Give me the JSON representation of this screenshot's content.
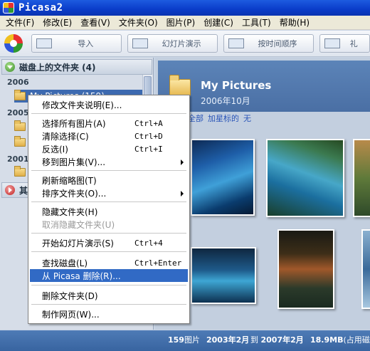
{
  "window": {
    "title": "Picasa2"
  },
  "menubar": [
    "文件(F)",
    "修改(E)",
    "查看(V)",
    "文件夹(O)",
    "图片(P)",
    "创建(C)",
    "工具(T)",
    "帮助(H)"
  ],
  "toolbar": {
    "import_label": "导入",
    "slideshow_label": "幻灯片演示",
    "timeline_label": "按时间顺序",
    "gift_label": "礼"
  },
  "left_panel": {
    "folders_on_disk": "磁盘上的文件夹 (4)",
    "other_section": "其",
    "years": [
      "2006",
      "2005",
      "2001"
    ],
    "selected_folder": "My Pictures (159)"
  },
  "main": {
    "folder_title": "My Pictures",
    "folder_date": "2006年10月",
    "filters": [
      "全部",
      "加星标的",
      "无"
    ]
  },
  "context_menu": {
    "items": [
      {
        "label": "修改文件夹说明(E)...",
        "shortcut": "",
        "submenu": false,
        "disabled": false,
        "highlighted": false
      },
      {
        "label": "选择所有图片(A)",
        "shortcut": "Ctrl+A",
        "submenu": false,
        "disabled": false,
        "highlighted": false
      },
      {
        "label": "清除选择(C)",
        "shortcut": "Ctrl+D",
        "submenu": false,
        "disabled": false,
        "highlighted": false
      },
      {
        "label": "反选(I)",
        "shortcut": "Ctrl+I",
        "submenu": false,
        "disabled": false,
        "highlighted": false
      },
      {
        "label": "移到图片集(V)...",
        "shortcut": "",
        "submenu": true,
        "disabled": false,
        "highlighted": false
      },
      {
        "label": "刷新缩略图(T)",
        "shortcut": "",
        "submenu": false,
        "disabled": false,
        "highlighted": false
      },
      {
        "label": "排序文件夹(O)...",
        "shortcut": "",
        "submenu": true,
        "disabled": false,
        "highlighted": false
      },
      {
        "label": "隐藏文件夹(H)",
        "shortcut": "",
        "submenu": false,
        "disabled": false,
        "highlighted": false
      },
      {
        "label": "取消隐藏文件夹(U)",
        "shortcut": "",
        "submenu": false,
        "disabled": true,
        "highlighted": false
      },
      {
        "label": "开始幻灯片演示(S)",
        "shortcut": "Ctrl+4",
        "submenu": false,
        "disabled": false,
        "highlighted": false
      },
      {
        "label": "查找磁盘(L)",
        "shortcut": "Ctrl+Enter",
        "submenu": false,
        "disabled": false,
        "highlighted": false
      },
      {
        "label": "从 Picasa 删除(R)...",
        "shortcut": "",
        "submenu": false,
        "disabled": false,
        "highlighted": true
      },
      {
        "label": "删除文件夹(D)",
        "shortcut": "",
        "submenu": false,
        "disabled": false,
        "highlighted": false
      },
      {
        "label": "制作网页(W)...",
        "shortcut": "",
        "submenu": false,
        "disabled": false,
        "highlighted": false
      }
    ]
  },
  "statusbar": {
    "count": "159",
    "count_unit": "图片",
    "date_from": "2003年2月",
    "to_word": "到",
    "date_to": "2007年2月",
    "size": "18.9MB",
    "size_note": "(占用磁盘"
  },
  "colors": {
    "titlebar": "#0a3cc9",
    "highlight": "#316ac5",
    "statusbar": "#3864a0"
  }
}
